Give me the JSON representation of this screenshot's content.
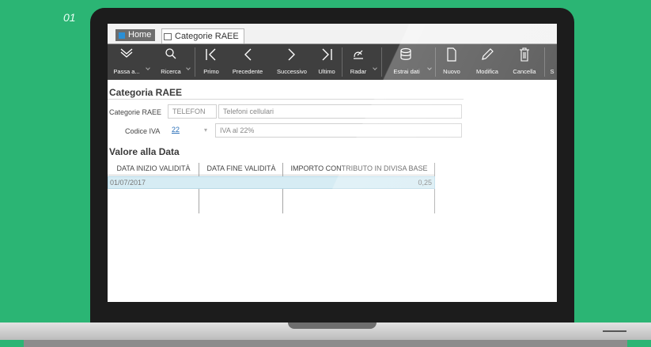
{
  "slide_number": "01",
  "tabs": {
    "home": "Home",
    "current": "Categorie RAEE"
  },
  "toolbar": {
    "passa": "Passa a...",
    "ricerca": "Ricerca",
    "primo": "Primo",
    "precedente": "Precedente",
    "successivo": "Successivo",
    "ultimo": "Ultimo",
    "radar": "Radar",
    "estrai": "Estrai dati",
    "nuovo": "Nuovo",
    "modifica": "Modifica",
    "cancella": "Cancella",
    "cut": "S"
  },
  "form": {
    "title": "Categoria RAEE",
    "categoria_label": "Categorie RAEE",
    "categoria_code": "TELEFON",
    "categoria_desc": "Telefoni cellulari",
    "iva_label": "Codice IVA",
    "iva_code": "22",
    "iva_desc": "IVA al 22%"
  },
  "grid": {
    "title": "Valore alla Data",
    "headers": [
      "DATA INIZIO VALIDITÀ",
      "DATA FINE VALIDITÀ",
      "IMPORTO CONTRIBUTO IN DIVISA BASE"
    ],
    "rows": [
      {
        "inizio": "01/07/2017",
        "fine": "",
        "importo": "0,25"
      }
    ]
  },
  "colors": {
    "background": "#2bb574",
    "toolbar": "#3f3f3f",
    "selected_row": "#d6ecf4"
  }
}
